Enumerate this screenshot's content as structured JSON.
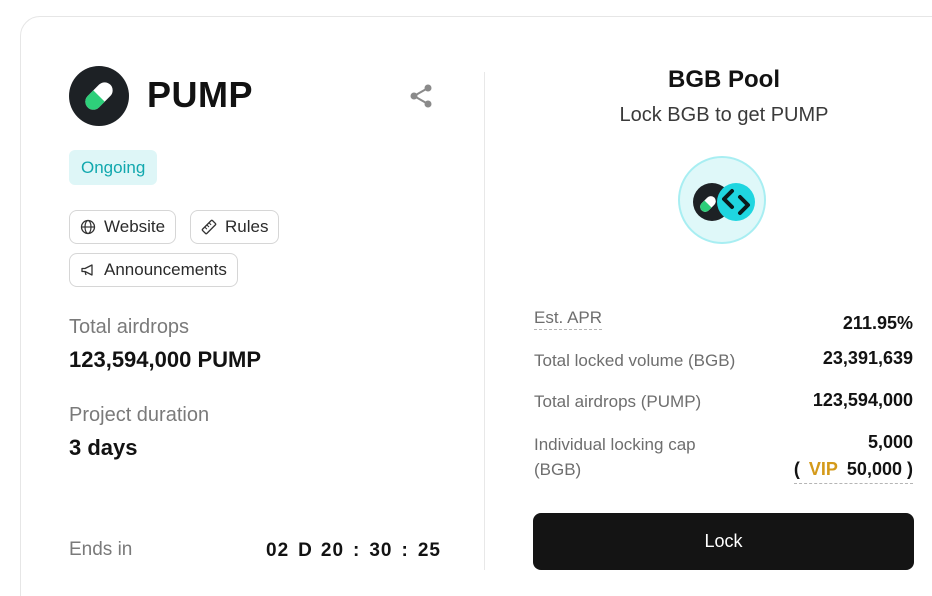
{
  "project": {
    "name": "PUMP",
    "status": "Ongoing",
    "logo_icon": "pill-capsule-icon",
    "share_icon": "share-icon"
  },
  "links": {
    "website": "Website",
    "rules": "Rules",
    "announcements": "Announcements"
  },
  "stats": {
    "total_airdrops_label": "Total airdrops",
    "total_airdrops_value": "123,594,000 PUMP",
    "duration_label": "Project duration",
    "duration_value": "3 days",
    "ends_label": "Ends in"
  },
  "countdown": {
    "days": "02",
    "days_unit": "D",
    "hours": "20",
    "minutes": "30",
    "seconds": "25",
    "separator": ":"
  },
  "pool": {
    "title": "BGB Pool",
    "subtitle": "Lock BGB to get PUMP",
    "apr_label": "Est. APR",
    "apr_value": "211.95%",
    "locked_label": "Total locked volume (BGB)",
    "locked_value": "23,391,639",
    "airdrops_label": "Total airdrops (PUMP)",
    "airdrops_value": "123,594,000",
    "cap_label": "Individual locking cap (BGB)",
    "cap_value": "5,000",
    "vip_open": "(",
    "vip_label": "VIP",
    "vip_value": "50,000",
    "vip_close": ")",
    "lock_button": "Lock"
  },
  "colors": {
    "accent_teal": "#11a8ae",
    "badge_bg": "#def6f7",
    "vip_gold": "#d49a1a",
    "button_bg": "#141414"
  }
}
